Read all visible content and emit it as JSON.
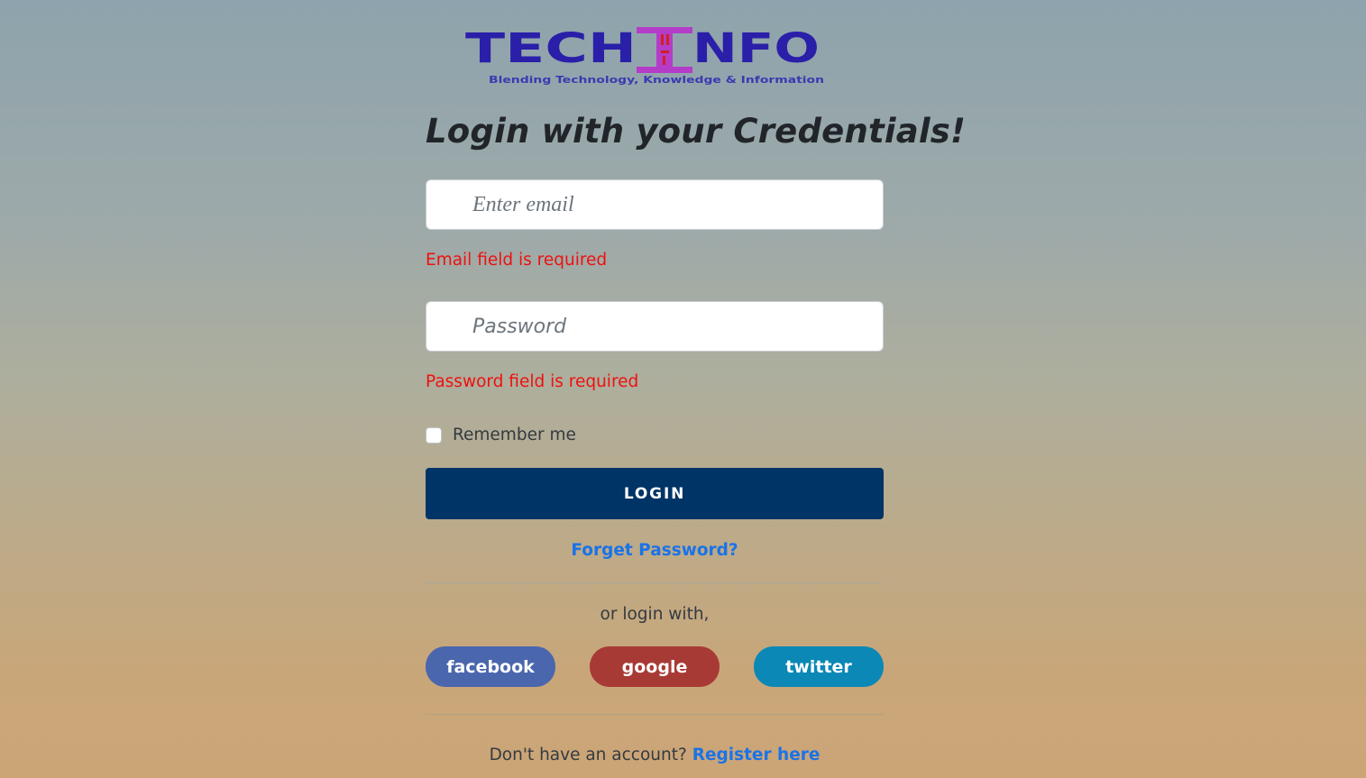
{
  "logo": {
    "text_left": "TECH",
    "text_mid": "I",
    "text_right": "NFO",
    "tagline": "Blending Technology, Knowledge & Information",
    "colors": {
      "primary": "#2a1fa8",
      "accent": "#b43cc8",
      "accent_dark": "#d12020"
    }
  },
  "title": "Login with your Credentials!",
  "email": {
    "placeholder": "Enter email",
    "value": "",
    "error": "Email field is required"
  },
  "password": {
    "placeholder": "Password",
    "value": "",
    "error": "Password field is required"
  },
  "remember": {
    "label": "Remember me",
    "checked": false
  },
  "login_button": "LOGIN",
  "forgot_link": "Forget Password?",
  "or_text": "or login with,",
  "social": [
    {
      "name": "facebook",
      "label": "facebook",
      "color": "#4a66ad"
    },
    {
      "name": "google",
      "label": "google",
      "color": "#a83a35"
    },
    {
      "name": "twitter",
      "label": "twitter",
      "color": "#0b88b6"
    }
  ],
  "register": {
    "prompt": "Don't have an account?",
    "link": "Register here"
  },
  "colors": {
    "error": "#ee1111",
    "link": "#1a73e8",
    "login_bg": "#003366"
  }
}
